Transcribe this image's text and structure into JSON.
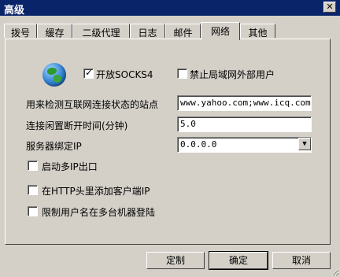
{
  "window": {
    "title": "高级"
  },
  "tabs": [
    {
      "label": "拨号"
    },
    {
      "label": "缓存"
    },
    {
      "label": "二级代理"
    },
    {
      "label": "日志"
    },
    {
      "label": "邮件"
    },
    {
      "label": "网络"
    },
    {
      "label": "其他"
    }
  ],
  "active_tab": "网络",
  "network": {
    "socks4": {
      "label": "开放SOCKS4",
      "checked": true
    },
    "block_outside": {
      "label": "禁止局域网外部用户",
      "checked": false
    },
    "check_sites": {
      "label": "用来检测互联网连接状态的站点",
      "value": "www.yahoo.com;www.icq.com;ww"
    },
    "idle_disconnect": {
      "label": "连接闲置断开时间(分钟)",
      "value": "5.0"
    },
    "bind_ip": {
      "label": "服务器绑定IP",
      "value": "0.0.0.0"
    },
    "multi_ip": {
      "label": "启动多IP出口",
      "checked": false
    },
    "http_header": {
      "label": "在HTTP头里添加客户端IP",
      "checked": false
    },
    "limit_user": {
      "label": "限制用户名在多台机器登陆",
      "checked": false
    }
  },
  "buttons": {
    "customize": "定制",
    "ok": "确定",
    "cancel": "取消"
  }
}
